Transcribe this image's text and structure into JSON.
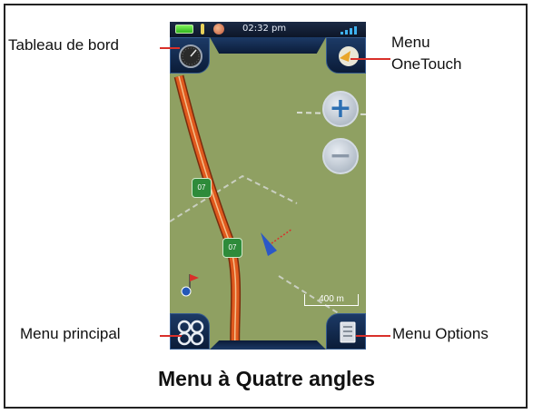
{
  "status_bar": {
    "time": "02:32 pm"
  },
  "corners": {
    "top_left": "Tableau de bord",
    "top_right_line1": "Menu",
    "top_right_line2": "OneTouch",
    "bottom_left": "Menu principal",
    "bottom_right": "Menu Options"
  },
  "map": {
    "scale_label": "400 m",
    "road_shield_1": "07",
    "road_shield_2": "07",
    "map_background_color": "#8fa062",
    "road_color": "#e05a1e"
  },
  "caption": "Menu à Quatre angles",
  "icons": {
    "top_left_button": "dashboard-gauge-icon",
    "top_right_button": "onetouch-menu-icon",
    "bottom_left_button": "main-menu-icon",
    "bottom_right_button": "options-menu-icon"
  }
}
